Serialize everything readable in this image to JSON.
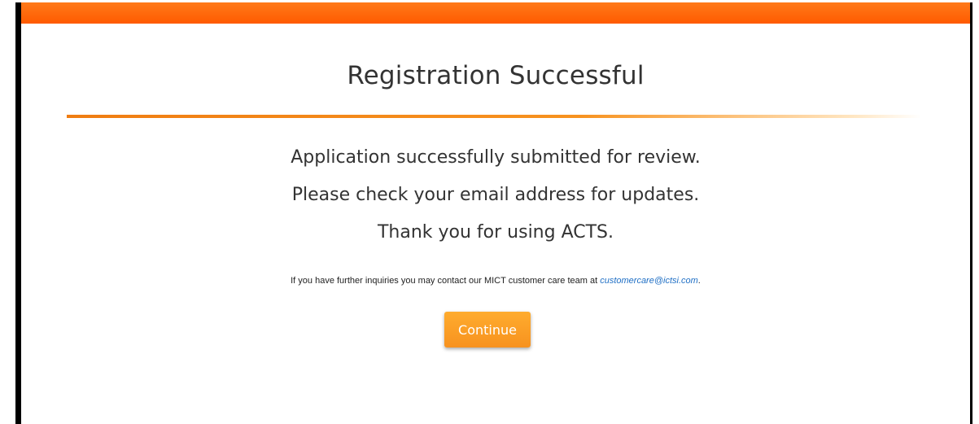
{
  "header": {
    "title": "Registration Successful"
  },
  "messages": [
    "Application successfully submitted for review.",
    "Please check your email address for updates.",
    "Thank you for using ACTS."
  ],
  "contact": {
    "text": "If you have further inquiries you may contact our MICT customer care team at ",
    "email": "customercare@ictsi.com",
    "suffix": "."
  },
  "actions": {
    "continue_label": "Continue"
  },
  "colors": {
    "accent": "#ff5a00",
    "button": "#f7921f",
    "link": "#1f6fc5"
  }
}
